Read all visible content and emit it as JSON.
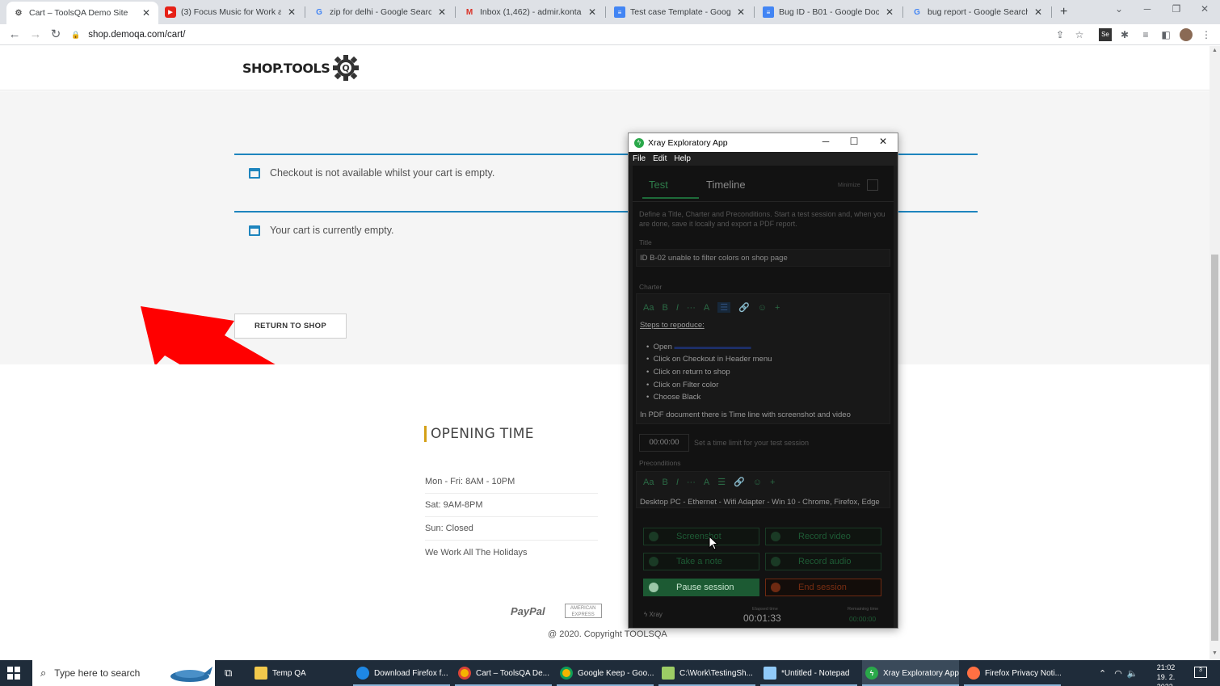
{
  "browser": {
    "tabs": [
      {
        "title": "Cart – ToolsQA Demo Site",
        "icon": "toolsqa-gear"
      },
      {
        "title": "(3) Focus Music for Work and St",
        "icon": "youtube"
      },
      {
        "title": "zip for delhi - Google Search",
        "icon": "google"
      },
      {
        "title": "Inbox (1,462) - admir.kontakt@g",
        "icon": "gmail"
      },
      {
        "title": "Test case Template - Google Do",
        "icon": "google-docs"
      },
      {
        "title": "Bug ID - B01 - Google Docs",
        "icon": "google-docs"
      },
      {
        "title": "bug report - Google Search",
        "icon": "google"
      }
    ],
    "new_tab": "+",
    "url": "shop.demoqa.com/cart/"
  },
  "site": {
    "logo_text": "SHOP.TOOLS",
    "logo_mark": "Q",
    "notices": [
      "Checkout is not available whilst your cart is empty.",
      "Your cart is currently empty."
    ],
    "return_button": "RETURN TO SHOP",
    "footer": {
      "opening_title": "OPENING TIME",
      "hours": [
        "Mon - Fri: 8AM - 10PM",
        "Sat: 9AM-8PM",
        "Sun: Closed",
        "We Work All The Holidays"
      ],
      "paypal": "PayPal",
      "amex": "AMERICAN EXPRESS",
      "copyright": "@ 2020. Copyright TOOLSQA"
    }
  },
  "xray": {
    "window_title": "Xray Exploratory App",
    "menu": [
      "File",
      "Edit",
      "Help"
    ],
    "tabs": [
      "Test",
      "Timeline"
    ],
    "minimize_label": "Minimize",
    "intro": "Define a Title, Charter and Preconditions. Start a test session and, when you are done, save it locally and export a PDF report.",
    "title_label": "Title",
    "title_value": "ID B-02 unable to filter colors on shop page",
    "charter_label": "Charter",
    "toolbar_items": [
      "Aa",
      "B",
      "I",
      "···",
      "A",
      "☰",
      "🔗",
      "☺",
      "+"
    ],
    "charter": {
      "heading": "Steps to repoduce:",
      "steps": [
        "Open",
        "Click on Checkout in Header menu",
        "Click on return to shop",
        "Click on Filter color",
        "Choose Black"
      ],
      "note": "In PDF document there is Time line with screenshot and video"
    },
    "time_limit": "00:00:00",
    "time_hint": "Set a time limit for your test session",
    "preconditions_label": "Preconditions",
    "preconditions_value": "Desktop PC - Ethernet - Wifi Adapter - Win 10 - Chrome, Firefox, Edge",
    "buttons": {
      "screenshot": "Screenshot",
      "record_video": "Record video",
      "take_note": "Take a note",
      "record_audio": "Record audio",
      "pause": "Pause session",
      "end": "End session"
    },
    "brand": "Xray",
    "elapsed_label": "Elapsed time",
    "elapsed": "00:01:33",
    "remaining_label": "Remaining time",
    "remaining": "00:00:00"
  },
  "taskbar": {
    "search_placeholder": "Type here to search",
    "apps": [
      {
        "label": "Temp QA",
        "color": "#f2c94c"
      },
      {
        "label": "Download Firefox f...",
        "color": "#1e88e5"
      },
      {
        "label": "Cart – ToolsQA De...",
        "color": "#f4b400"
      },
      {
        "label": "Google Keep - Goo...",
        "color": "#f4b400"
      },
      {
        "label": "C:\\Work\\TestingSh...",
        "color": "#9ccc65"
      },
      {
        "label": "*Untitled - Notepad",
        "color": "#90caf9"
      },
      {
        "label": "Xray Exploratory App",
        "color": "#2aa84a"
      },
      {
        "label": "Firefox Privacy Noti...",
        "color": "#ff7043"
      }
    ],
    "time": "21:02",
    "date": "19. 2. 2023.",
    "notification_count": "3"
  }
}
